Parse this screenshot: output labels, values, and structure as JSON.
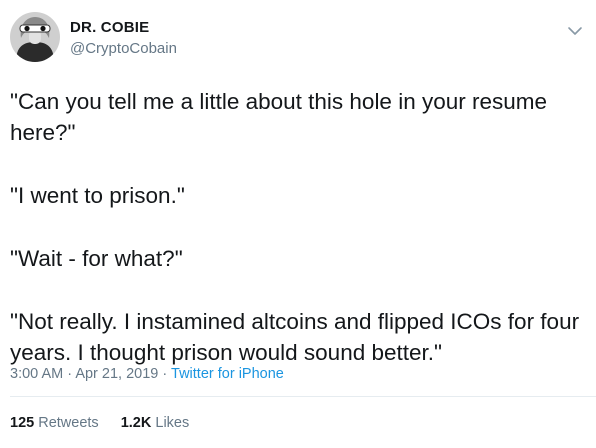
{
  "tweet": {
    "author": {
      "display_name": "DR. COBIE",
      "handle": "@CryptoCobain",
      "avatar_icon": "profile-avatar"
    },
    "menu_icon": "chevron-down-icon",
    "paragraphs": [
      "\"Can you tell me a little about this hole in your resume here?\"",
      "\"I went to prison.\"",
      "\"Wait - for what?\"",
      "\"Not really. I instamined altcoins and flipped ICOs for four years. I thought prison would sound better.\""
    ],
    "time": "3:00 AM",
    "date": "Apr 21, 2019",
    "separator": "·",
    "source": "Twitter for iPhone",
    "retweets": {
      "count": "125",
      "label": "Retweets"
    },
    "likes": {
      "count": "1.2K",
      "label": "Likes"
    }
  },
  "colors": {
    "text": "#14171a",
    "secondary": "#657786",
    "link": "#1b95e0",
    "divider": "#e6ecf0"
  }
}
